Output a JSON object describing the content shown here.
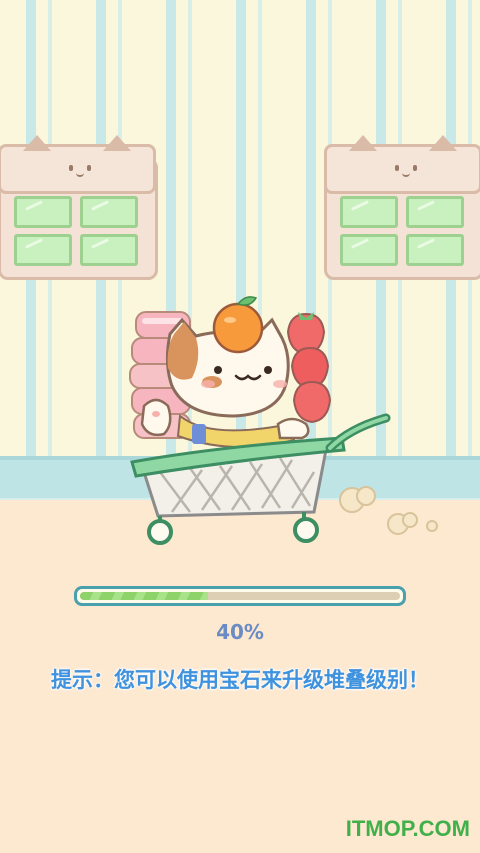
{
  "progress": {
    "value": 0.4,
    "percent_text": "40%"
  },
  "hint": {
    "text": "提示：您可以使用宝石来升级堆叠级别！"
  },
  "watermark": {
    "text": "ITMOP.COM"
  },
  "colors": {
    "accent": "#3f92de",
    "progress_fill": "#8ed26a",
    "track_border": "#4aa0ad",
    "watermark": "#42b04a"
  },
  "scene": {
    "character": "cat-in-shopping-cart",
    "decorations": [
      "cat-window-left",
      "cat-window-right",
      "tangerine",
      "strawberries",
      "cake-stack"
    ]
  }
}
